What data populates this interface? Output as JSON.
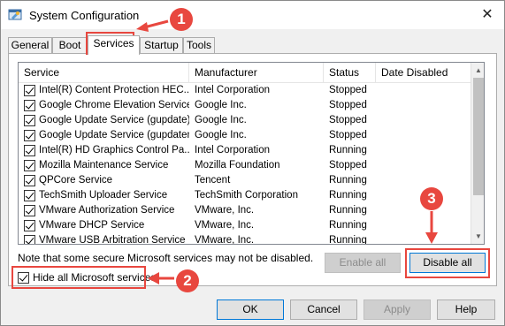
{
  "window": {
    "title": "System Configuration",
    "close_glyph": "✕",
    "app_icon": "system-config-icon"
  },
  "tabs": [
    {
      "label": "General",
      "active": false
    },
    {
      "label": "Boot",
      "active": false
    },
    {
      "label": "Services",
      "active": true
    },
    {
      "label": "Startup",
      "active": false
    },
    {
      "label": "Tools",
      "active": false
    }
  ],
  "services_list": {
    "columns": [
      "Service",
      "Manufacturer",
      "Status",
      "Date Disabled"
    ],
    "rows": [
      {
        "name": "Intel(R) Content Protection HEC...",
        "manufacturer": "Intel Corporation",
        "status": "Stopped",
        "date_disabled": "",
        "checked": true
      },
      {
        "name": "Google Chrome Elevation Service",
        "manufacturer": "Google Inc.",
        "status": "Stopped",
        "date_disabled": "",
        "checked": true
      },
      {
        "name": "Google Update Service (gupdate)",
        "manufacturer": "Google Inc.",
        "status": "Stopped",
        "date_disabled": "",
        "checked": true
      },
      {
        "name": "Google Update Service (gupdatem)",
        "manufacturer": "Google Inc.",
        "status": "Stopped",
        "date_disabled": "",
        "checked": true
      },
      {
        "name": "Intel(R) HD Graphics Control Pa...",
        "manufacturer": "Intel Corporation",
        "status": "Running",
        "date_disabled": "",
        "checked": true
      },
      {
        "name": "Mozilla Maintenance Service",
        "manufacturer": "Mozilla Foundation",
        "status": "Stopped",
        "date_disabled": "",
        "checked": true
      },
      {
        "name": "QPCore Service",
        "manufacturer": "Tencent",
        "status": "Running",
        "date_disabled": "",
        "checked": true
      },
      {
        "name": "TechSmith Uploader Service",
        "manufacturer": "TechSmith Corporation",
        "status": "Running",
        "date_disabled": "",
        "checked": true
      },
      {
        "name": "VMware Authorization Service",
        "manufacturer": "VMware, Inc.",
        "status": "Running",
        "date_disabled": "",
        "checked": true
      },
      {
        "name": "VMware DHCP Service",
        "manufacturer": "VMware, Inc.",
        "status": "Running",
        "date_disabled": "",
        "checked": true
      },
      {
        "name": "VMware USB Arbitration Service",
        "manufacturer": "VMware, Inc.",
        "status": "Running",
        "date_disabled": "",
        "checked": true
      }
    ]
  },
  "note": "Note that some secure Microsoft services may not be disabled.",
  "buttons": {
    "enable_all": "Enable all",
    "disable_all": "Disable all",
    "ok": "OK",
    "cancel": "Cancel",
    "apply": "Apply",
    "help": "Help"
  },
  "hide_microsoft": {
    "label": "Hide all Microsoft services",
    "checked": true
  },
  "annotations": {
    "step1": "1",
    "step2": "2",
    "step3": "3",
    "color": "#e8473f"
  }
}
